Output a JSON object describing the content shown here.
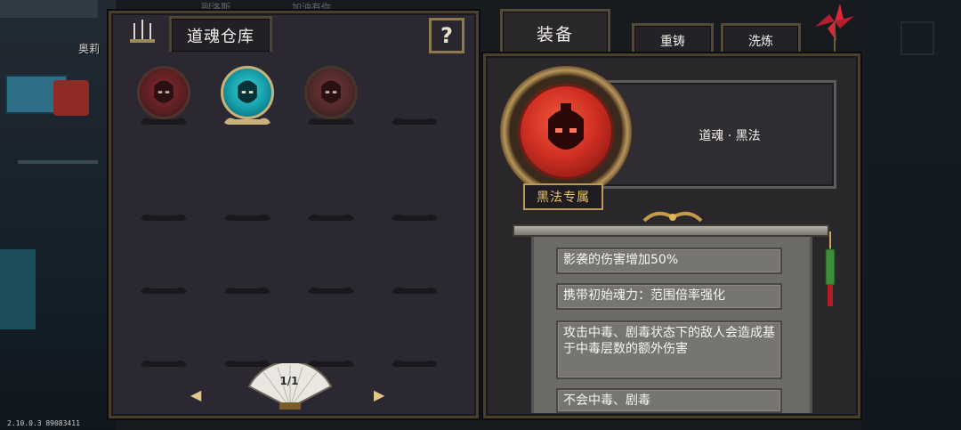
{
  "game_hud": {
    "npc_name": "奥莉",
    "top_clipped_labels": [
      "副洛斯",
      "加油有你"
    ],
    "version": "2.10.0.3 89083411"
  },
  "warehouse": {
    "title": "道魂仓库",
    "help_label": "?",
    "page_indicator": "1/1",
    "slots": [
      {
        "state": "soul",
        "color": "red",
        "selected": false
      },
      {
        "state": "soul",
        "color": "teal",
        "selected": true
      },
      {
        "state": "soul",
        "color": "brown",
        "selected": false
      },
      {
        "state": "empty"
      },
      {
        "state": "empty"
      },
      {
        "state": "empty"
      },
      {
        "state": "empty"
      },
      {
        "state": "empty"
      },
      {
        "state": "empty"
      },
      {
        "state": "empty"
      },
      {
        "state": "empty"
      },
      {
        "state": "empty"
      },
      {
        "state": "empty"
      },
      {
        "state": "empty"
      },
      {
        "state": "empty"
      },
      {
        "state": "empty"
      }
    ],
    "prev_icon": "arrow-left-icon",
    "next_icon": "arrow-right-icon"
  },
  "equip": {
    "tabs": [
      {
        "label": "装备",
        "active": true
      },
      {
        "label": "重铸",
        "active": false
      },
      {
        "label": "洗炼",
        "active": false
      }
    ],
    "item_name": "道魂 · 黑法",
    "exclusive_tag": "黑法专属",
    "stats": [
      "影袭的伤害增加50%",
      "携带初始魂力：范围倍率强化",
      "攻击中毒、剧毒状态下的敌人会造成基于中毒层数的额外伤害",
      "不会中毒、剧毒"
    ]
  },
  "colors": {
    "panel_bg": "#2c2831",
    "frame_gold": "#b99a57",
    "orb_red": "#cf2f22",
    "orb_teal": "#139aa6",
    "tag_text": "#e9c46a"
  }
}
